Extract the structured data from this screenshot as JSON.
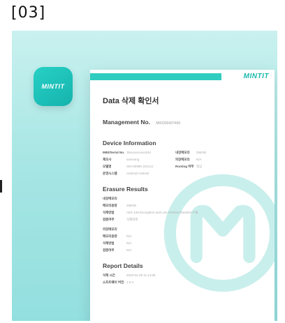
{
  "step_label": "[03]",
  "app": {
    "icon_text": "MINTIT"
  },
  "doc": {
    "logo": "MINTIT",
    "title": "Data 삭제 확인서",
    "management_label": "Management No.",
    "management_value": "M00300437460",
    "device_heading": "Device Information",
    "device_rows": [
      {
        "k1": "IMEI/Serial No.",
        "v1": "35xxxxxxxxxx534",
        "k2": "내장메모리",
        "v2": "256GB"
      },
      {
        "k1": "제조사",
        "v1": "samsung",
        "k2": "외장메모리",
        "v2": "N/A"
      },
      {
        "k1": "모델명",
        "v1": "SM-G998N (S21U)",
        "k2": "Rooting 여부",
        "v2": "정상"
      },
      {
        "k1": "운영시스템",
        "v1": "Android Android",
        "k2": "",
        "v2": ""
      }
    ],
    "erasure_heading": "Erasure Results",
    "erasure_groups": [
      {
        "label": "내장메모리",
        "rows": [
          {
            "k": "메모리용량",
            "v": "256GB"
          },
          {
            "k": "삭제방법",
            "v": "AES 128 Encryption and Low Format (Random Fill)"
          },
          {
            "k": "검증여부",
            "v": "삭제완료"
          }
        ]
      },
      {
        "label": "외장메모리",
        "rows": [
          {
            "k": "메모리용량",
            "v": "N/A"
          },
          {
            "k": "삭제방법",
            "v": "N/A"
          },
          {
            "k": "검증여부",
            "v": "N/A"
          }
        ]
      }
    ],
    "report_heading": "Report Details",
    "report_rows": [
      {
        "k": "삭제 시간",
        "v": "2020-04-28 11:14:06"
      },
      {
        "k": "소프트웨어 버전",
        "v": "1.6.4"
      }
    ]
  },
  "colors": {
    "accent": "#2fcdbf",
    "panel": "#a7e6e4"
  }
}
